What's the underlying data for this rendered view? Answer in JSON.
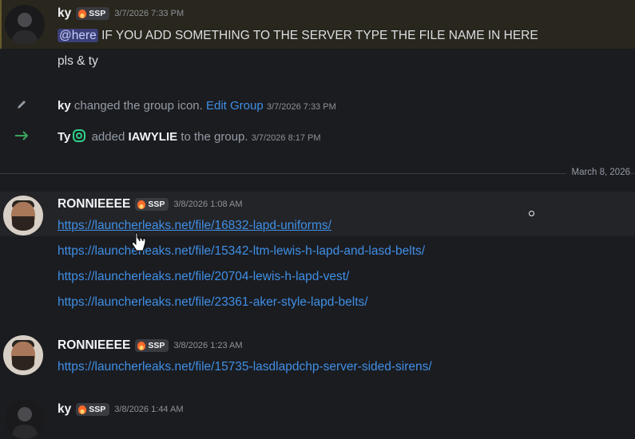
{
  "messages": {
    "m1": {
      "author": "ky",
      "tag": "SSP",
      "timestamp": "3/7/2026 7:33 PM",
      "mention": "@here",
      "text": " IF YOU ADD SOMETHING TO THE SERVER TYPE THE FILE NAME IN HERE",
      "line2": "pls & ty"
    },
    "sys1": {
      "actor": "ky",
      "action": "changed the group icon.",
      "link": "Edit Group",
      "timestamp": "3/7/2026 7:33 PM"
    },
    "sys2": {
      "actor": "Ty",
      "action_pre": "added",
      "target": "IAWYLIE",
      "action_post": "to the group.",
      "timestamp": "3/7/2026 8:17 PM"
    },
    "date_divider": "March 8, 2026",
    "m2": {
      "author": "RONNIEEEE",
      "tag": "SSP",
      "timestamp": "3/8/2026 1:08 AM",
      "links": [
        "https://launcherleaks.net/file/16832-lapd-uniforms/",
        "https://launcherleaks.net/file/15342-ltm-lewis-h-lapd-and-lasd-belts/",
        "https://launcherleaks.net/file/20704-lewis-h-lapd-vest/",
        "https://launcherleaks.net/file/23361-aker-style-lapd-belts/"
      ]
    },
    "m3": {
      "author": "RONNIEEEE",
      "tag": "SSP",
      "timestamp": "3/8/2026 1:23 AM",
      "link": "https://launcherleaks.net/file/15735-lasdlapdchp-server-sided-sirens/"
    },
    "m4": {
      "author": "ky",
      "tag": "SSP",
      "timestamp": "3/8/2026 1:44 AM"
    }
  },
  "colors": {
    "link": "#3f8fe6",
    "mention_bg": "#3b3f77",
    "system_join": "#3ba55d"
  }
}
